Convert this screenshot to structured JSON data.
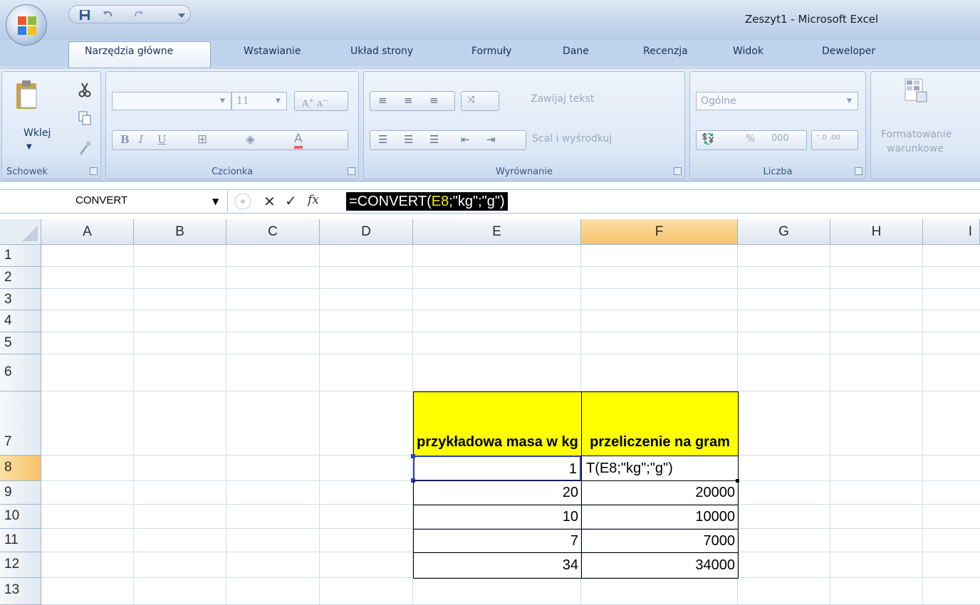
{
  "window": {
    "title": "Zeszyt1 - Microsoft Excel"
  },
  "tabs": [
    "Narzędzia główne",
    "Wstawianie",
    "Układ strony",
    "Formuły",
    "Dane",
    "Recenzja",
    "Widok",
    "Deweloper"
  ],
  "ribbon": {
    "clipboard": {
      "paste_label": "Wklej",
      "group_label": "Schowek"
    },
    "font": {
      "font_size": "11",
      "group_label": "Czcionka"
    },
    "alignment": {
      "wrap_text": "Zawijaj tekst",
      "merge_center": "Scal i wyśrodkuj",
      "group_label": "Wyrównanie"
    },
    "number": {
      "format": "Ogólne",
      "percent": "%",
      "thousands": "000",
      "group_label": "Liczba"
    },
    "styles": {
      "conditional_line1": "Formatowanie",
      "conditional_line2": "warunkowe"
    }
  },
  "formula_bar": {
    "name_box": "CONVERT",
    "formula_prefix": "=CONVERT(",
    "formula_ref": "E8",
    "formula_suffix": ";\"kg\";\"g\")"
  },
  "columns": [
    "A",
    "B",
    "C",
    "D",
    "E",
    "F",
    "G",
    "H",
    "I"
  ],
  "rows": [
    "1",
    "2",
    "3",
    "4",
    "5",
    "6",
    "7",
    "8",
    "9",
    "10",
    "11",
    "12",
    "13"
  ],
  "cells": {
    "E7": "przykładowa masa w kg",
    "F7": "przeliczenie na gram",
    "E8": "1",
    "F8": "T(E8;\"kg\";\"g\")",
    "E9": "20",
    "F9": "20000",
    "E10": "10",
    "F10": "10000",
    "E11": "7",
    "F11": "7000",
    "E12": "34",
    "F12": "34000"
  },
  "colors": {
    "header_fill": "#ffff00",
    "selected_header": "#f7c26b",
    "formula_highlight": "#f5e70b"
  }
}
